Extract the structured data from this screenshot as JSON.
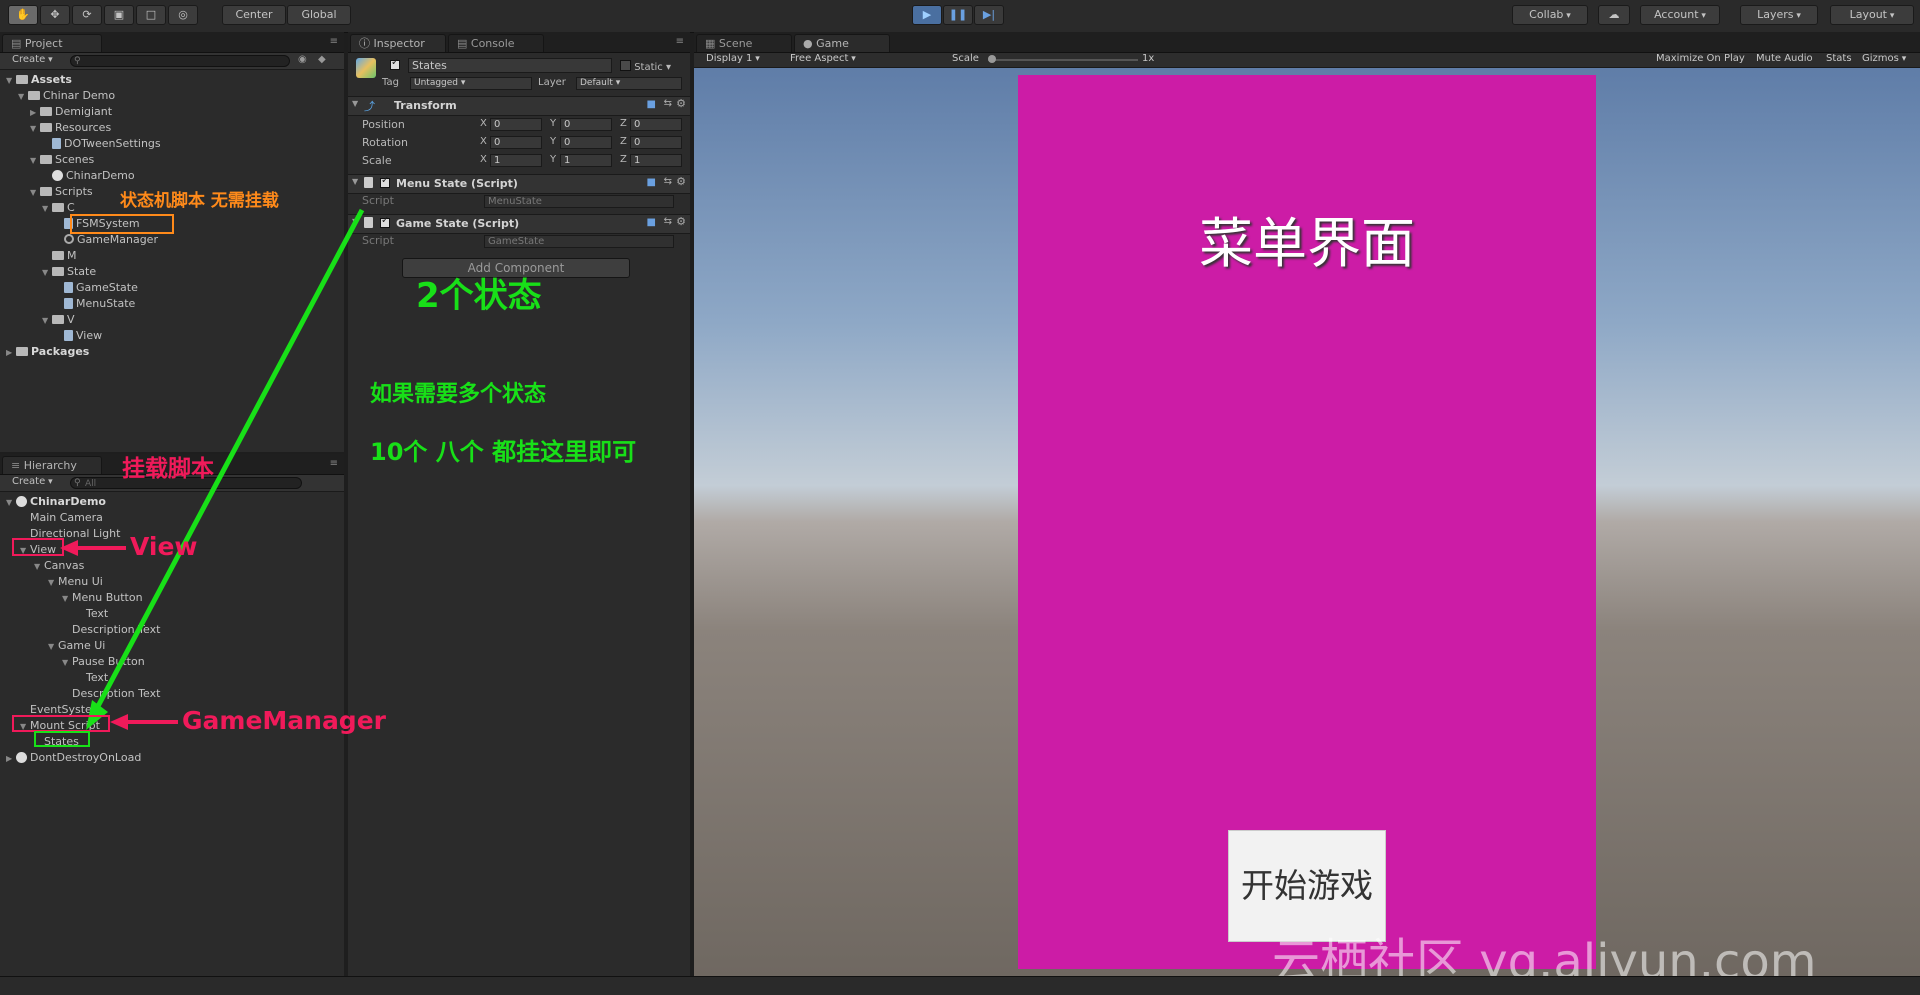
{
  "toolbar": {
    "pivot_center": "Center",
    "pivot_global": "Global",
    "collab": "Collab",
    "account": "Account",
    "layers": "Layers",
    "layout": "Layout"
  },
  "project": {
    "tab": "Project",
    "create": "Create",
    "tree": [
      {
        "label": "Assets",
        "indent": 0,
        "icon": "folder",
        "bold": true,
        "open": true
      },
      {
        "label": "Chinar Demo",
        "indent": 1,
        "icon": "folder",
        "open": true
      },
      {
        "label": "Demigiant",
        "indent": 2,
        "icon": "folder",
        "closed": true
      },
      {
        "label": "Resources",
        "indent": 2,
        "icon": "folder",
        "open": true
      },
      {
        "label": "DOTweenSettings",
        "indent": 3,
        "icon": "file"
      },
      {
        "label": "Scenes",
        "indent": 2,
        "icon": "folder",
        "open": true
      },
      {
        "label": "ChinarDemo",
        "indent": 3,
        "icon": "scene"
      },
      {
        "label": "Scripts",
        "indent": 2,
        "icon": "folder",
        "open": true
      },
      {
        "label": "C",
        "indent": 3,
        "icon": "folder",
        "open": true
      },
      {
        "label": "FSMSystem",
        "indent": 4,
        "icon": "file"
      },
      {
        "label": "GameManager",
        "indent": 4,
        "icon": "gear"
      },
      {
        "label": "M",
        "indent": 3,
        "icon": "folder"
      },
      {
        "label": "State",
        "indent": 3,
        "icon": "folder",
        "open": true
      },
      {
        "label": "GameState",
        "indent": 4,
        "icon": "file"
      },
      {
        "label": "MenuState",
        "indent": 4,
        "icon": "file"
      },
      {
        "label": "V",
        "indent": 3,
        "icon": "folder",
        "open": true
      },
      {
        "label": "View",
        "indent": 4,
        "icon": "file"
      },
      {
        "label": "Packages",
        "indent": 0,
        "icon": "folder",
        "bold": true,
        "closed": true
      }
    ]
  },
  "hierarchy": {
    "tab": "Hierarchy",
    "create": "Create",
    "search_placeholder": "All",
    "tree": [
      {
        "label": "ChinarDemo",
        "indent": 0,
        "icon": "scene",
        "bold": true,
        "open": true
      },
      {
        "label": "Main Camera",
        "indent": 1
      },
      {
        "label": "Directional Light",
        "indent": 1
      },
      {
        "label": "View",
        "indent": 1,
        "open": true
      },
      {
        "label": "Canvas",
        "indent": 2,
        "open": true
      },
      {
        "label": "Menu Ui",
        "indent": 3,
        "open": true
      },
      {
        "label": "Menu Button",
        "indent": 4,
        "open": true
      },
      {
        "label": "Text",
        "indent": 5
      },
      {
        "label": "Description Text",
        "indent": 4
      },
      {
        "label": "Game Ui",
        "indent": 3,
        "open": true
      },
      {
        "label": "Pause Button",
        "indent": 4,
        "open": true
      },
      {
        "label": "Text",
        "indent": 5
      },
      {
        "label": "Description Text",
        "indent": 4
      },
      {
        "label": "EventSystem",
        "indent": 1
      },
      {
        "label": "Mount Script",
        "indent": 1,
        "open": true
      },
      {
        "label": "States",
        "indent": 2
      },
      {
        "label": "DontDestroyOnLoad",
        "indent": 0,
        "icon": "scene",
        "closed": true
      }
    ]
  },
  "inspector": {
    "tab": "Inspector",
    "tab2": "Console",
    "object_name": "States",
    "static_label": "Static",
    "tag_label": "Tag",
    "tag_value": "Untagged",
    "layer_label": "Layer",
    "layer_value": "Default",
    "transform": {
      "title": "Transform",
      "position_label": "Position",
      "rotation_label": "Rotation",
      "scale_label": "Scale",
      "position": [
        "0",
        "0",
        "0"
      ],
      "rotation": [
        "0",
        "0",
        "0"
      ],
      "scale": [
        "1",
        "1",
        "1"
      ]
    },
    "axis": [
      "X",
      "Y",
      "Z"
    ],
    "components": [
      {
        "title": "Menu State (Script)",
        "script_label": "Script",
        "script_value": "MenuState"
      },
      {
        "title": "Game State (Script)",
        "script_label": "Script",
        "script_value": "GameState"
      }
    ],
    "add_component": "Add Component"
  },
  "game": {
    "tab_scene": "Scene",
    "tab_game": "Game",
    "display": "Display 1",
    "aspect": "Free Aspect",
    "scale_label": "Scale",
    "scale_value": "1x",
    "maximize": "Maximize On Play",
    "mute": "Mute Audio",
    "stats": "Stats",
    "gizmos": "Gizmos",
    "menu_title": "菜单界面",
    "start_button": "开始游戏",
    "canvas_color": "#cc1ca6"
  },
  "annotations": {
    "no_mount": "状态机脚本 无需挂载",
    "two_states": "2个状态",
    "need_many": "如果需要多个状态",
    "ten_eight": "10个 八个 都挂这里即可",
    "mount_script": "挂载脚本",
    "view": "View",
    "game_manager": "GameManager"
  },
  "watermark": "云栖社区 yq.aliyun.com"
}
